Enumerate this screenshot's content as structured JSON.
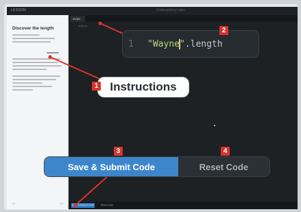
{
  "app": {
    "title": "LESSON",
    "center_title": "Codecademy Labs"
  },
  "instructions_panel": {
    "title": "Discover the length"
  },
  "editor": {
    "tab_label": "script",
    "gutter_label": "script.js",
    "code": {
      "line_number": "1",
      "string_part1": "\"Wayne",
      "string_part2": "\"",
      "property": ".length"
    }
  },
  "action_bar": {
    "submit_label": "Save & Submit Code",
    "reset_label": "Reset Code"
  },
  "callouts": {
    "instructions_label": "Instructions",
    "submit_label": "Save & Submit Code",
    "reset_label": "Reset Code"
  },
  "badges": [
    "1",
    "2",
    "3",
    "4"
  ],
  "colors": {
    "badge": "#d9342b",
    "submit": "#3d86cc",
    "string": "#b9d77e",
    "editor_bg": "#1d2124"
  }
}
